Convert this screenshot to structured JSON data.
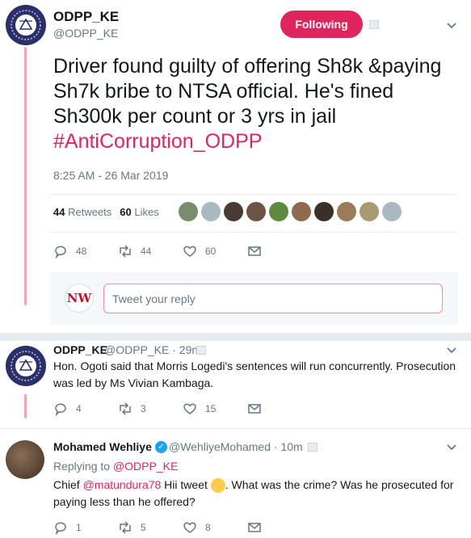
{
  "main_tweet": {
    "name": "ODPP_KE",
    "handle": "@ODPP_KE",
    "follow_label": "Following",
    "text": "Driver found guilty of offering Sh8k &paying Sh7k bribe to NTSA official. He's fined Sh300k per count or 3 yrs in jail ",
    "hashtag": "#AntiCorruption_ODPP",
    "timestamp": "8:25 AM - 26 Mar 2019",
    "retweets_count": "44",
    "retweets_label": "Retweets",
    "likes_count": "60",
    "likes_label": "Likes",
    "actions": {
      "replies": "48",
      "retweets": "44",
      "likes": "60"
    }
  },
  "reply_box": {
    "logo_text": "NW",
    "placeholder": "Tweet your reply"
  },
  "reply_1": {
    "name": "ODPP_KE",
    "handle_time": "@ODPP_KE · 29m",
    "text": "Hon. Ogoti said that Morris Logedi's sentences will run concurrently. Prosecution was led by Ms Vivian Kambaga.",
    "actions": {
      "replies": "4",
      "retweets": "3",
      "likes": "15"
    }
  },
  "reply_2": {
    "name": "Mohamed Wehliye",
    "handle_time": "@WehliyeMohamed · 10m",
    "replying_prefix": "Replying to",
    "replying_to": "@ODPP_KE",
    "text_before": "Chief ",
    "mention": "@matundura78",
    "text_mid": " Hii tweet ",
    "text_after": ". What was the crime? Was he prosecuted for paying less than he offered?",
    "actions": {
      "replies": "1",
      "retweets": "5",
      "likes": "8"
    }
  },
  "colors": {
    "accent": "#e0245e",
    "thread_line": "#f5a3b1",
    "muted": "#657786",
    "verified": "#1da1f2"
  }
}
